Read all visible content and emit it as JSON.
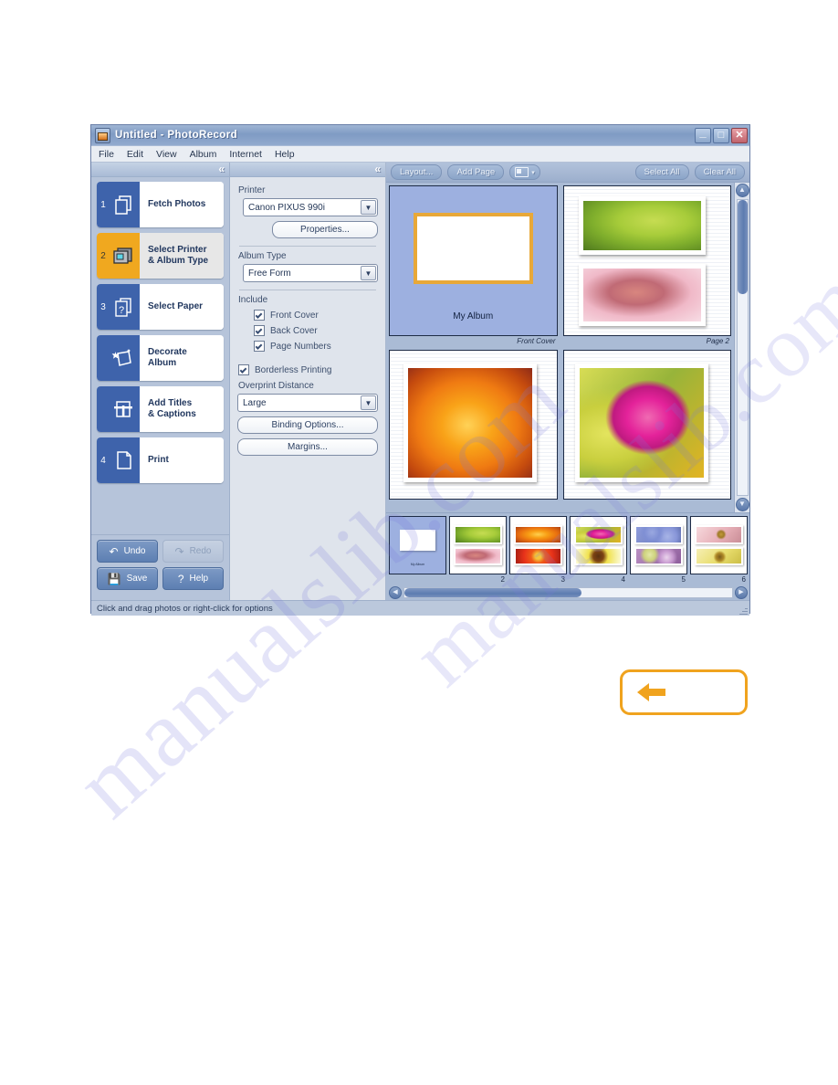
{
  "window": {
    "title": "Untitled - PhotoRecord",
    "icon": "photorecord-app-icon",
    "minimize_label": "_",
    "maximize_label": "□",
    "close_label": "✕"
  },
  "menu": {
    "items": [
      {
        "label": "File"
      },
      {
        "label": "Edit"
      },
      {
        "label": "View"
      },
      {
        "label": "Album"
      },
      {
        "label": "Internet"
      },
      {
        "label": "Help"
      }
    ]
  },
  "collapse": {
    "chevron": "«"
  },
  "steps": [
    {
      "num": "1",
      "label": "Fetch Photos",
      "icon": "fetch-photos-icon",
      "active": false
    },
    {
      "num": "2",
      "label": "Select Printer\n& Album Type",
      "icon": "select-printer-icon",
      "active": true
    },
    {
      "num": "3",
      "label": "Select Paper",
      "icon": "select-paper-icon",
      "active": false
    },
    {
      "num": "",
      "label": "Decorate\nAlbum",
      "icon": "decorate-album-icon",
      "active": false
    },
    {
      "num": "",
      "label": "Add Titles\n& Captions",
      "icon": "add-titles-icon",
      "active": false
    },
    {
      "num": "4",
      "label": "Print",
      "icon": "print-icon",
      "active": false
    }
  ],
  "left_buttons": {
    "undo": {
      "label": "Undo",
      "icon": "undo-arrow-icon",
      "enabled": true
    },
    "redo": {
      "label": "Redo",
      "icon": "redo-arrow-icon",
      "enabled": false
    },
    "save": {
      "label": "Save",
      "icon": "floppy-disk-icon",
      "enabled": true
    },
    "help": {
      "label": "Help",
      "icon": "question-mark-icon",
      "enabled": true
    }
  },
  "settings": {
    "printer_label": "Printer",
    "printer_value": "Canon PIXUS 990i",
    "properties_button": "Properties...",
    "album_type_label": "Album Type",
    "album_type_value": "Free Form",
    "include_label": "Include",
    "include_options": [
      {
        "label": "Front Cover",
        "checked": true
      },
      {
        "label": "Back Cover",
        "checked": true
      },
      {
        "label": "Page Numbers",
        "checked": true
      }
    ],
    "borderless_label": "Borderless Printing",
    "borderless_checked": true,
    "overprint_label": "Overprint Distance",
    "overprint_value": "Large",
    "binding_button": "Binding Options...",
    "margins_button": "Margins..."
  },
  "toolbar": {
    "layout_button": "Layout...",
    "add_page_button": "Add Page",
    "view_dropdown_icon": "page-view-icon",
    "view_dropdown_caret": "▾",
    "select_all_button": "Select All",
    "clear_all_button": "Clear All"
  },
  "preview": {
    "pages": [
      {
        "caption": "Front Cover",
        "type": "cover",
        "title": "My Album",
        "photos": [
          {
            "style": "img-pink-daisy"
          }
        ]
      },
      {
        "caption": "Page  2",
        "type": "page",
        "photos": [
          {
            "style": "img-green-buds"
          },
          {
            "style": "img-pink-bud"
          }
        ]
      },
      {
        "caption": "",
        "type": "page",
        "photos": [
          {
            "style": "img-orange-rose"
          }
        ]
      },
      {
        "caption": "",
        "type": "page",
        "photos": [
          {
            "style": "img-magenta-bouquet"
          }
        ]
      }
    ],
    "scroll_up": "▲",
    "scroll_down": "▼"
  },
  "filmstrip": {
    "scroll_left": "◀",
    "scroll_right": "▶",
    "thumbs": [
      {
        "number": "",
        "selected": true,
        "cover": true,
        "cover_label": "My Album",
        "photos": [
          {
            "style": "img-pink-daisy"
          }
        ]
      },
      {
        "number": "2",
        "selected": false,
        "cover": false,
        "photos": [
          {
            "style": "img-green-buds"
          },
          {
            "style": "img-pink-bud"
          }
        ]
      },
      {
        "number": "3",
        "selected": false,
        "cover": false,
        "photos": [
          {
            "style": "img-orange-ranunculus"
          },
          {
            "style": "img-red-gerbera"
          }
        ]
      },
      {
        "number": "4",
        "selected": false,
        "cover": false,
        "photos": [
          {
            "style": "img-magenta-bouquet"
          },
          {
            "style": "img-sunflower"
          }
        ]
      },
      {
        "number": "5",
        "selected": false,
        "cover": false,
        "photos": [
          {
            "style": "img-blue-hydrangea"
          },
          {
            "style": "img-purple-cluster"
          }
        ]
      },
      {
        "number": "6",
        "selected": false,
        "cover": false,
        "photos": [
          {
            "style": "img-bee-pink"
          },
          {
            "style": "img-bee-yellow"
          }
        ]
      },
      {
        "number": "",
        "selected": false,
        "cover": false,
        "photos": [
          {
            "style": "img-pink-magenta-top"
          }
        ]
      }
    ]
  },
  "status_bar": {
    "text": "Click and drag photos or right-click for options"
  },
  "back_button": {
    "icon": "left-arrow-icon",
    "color": "#f0a31e"
  },
  "watermark": {
    "text_1": "manualslib.com",
    "text_2": "manualslib.com"
  },
  "colors": {
    "title_bar": "#7f9bc4",
    "step_blue": "#3e63ab",
    "step_active_orange": "#f0a81f",
    "panel_blue": "#b6c4da",
    "settings_panel": "#dfe4ec",
    "cover_page": "#9db0e0",
    "accent_orange": "#f0a31e"
  }
}
